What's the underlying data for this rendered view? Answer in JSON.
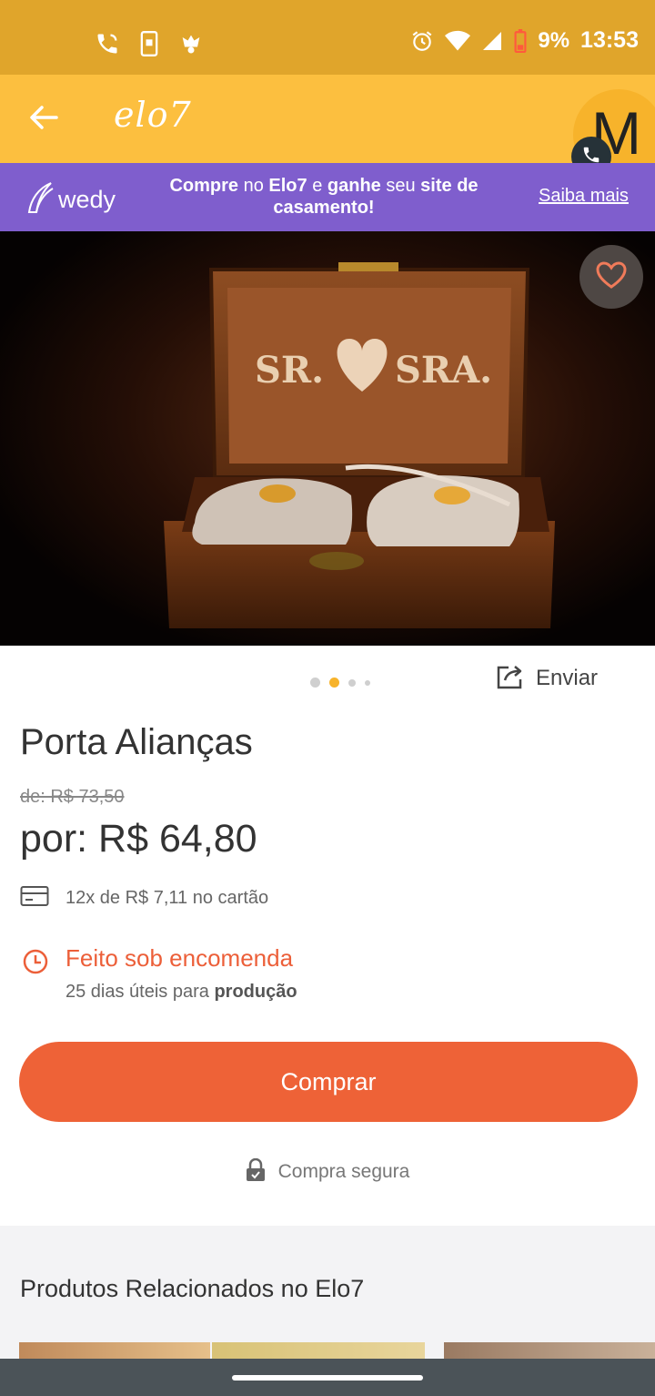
{
  "status_bar": {
    "time": "13:53",
    "battery": "9%",
    "icons_left": [
      "call-icon",
      "phone-screen-icon",
      "app-notification-icon"
    ],
    "icons_right": [
      "alarm-icon",
      "wifi-icon",
      "signal-icon",
      "battery-low-icon"
    ]
  },
  "app_bar": {
    "logo": "elo7",
    "avatar_letter": "M"
  },
  "banner": {
    "brand": "wedy",
    "text_part1": "Compre",
    "text_part2": " no ",
    "text_part3": "Elo7",
    "text_part4": " e ",
    "text_part5": "ganhe",
    "text_part6": " seu ",
    "text_part7": "site de casamento!",
    "link": "Saiba mais",
    "color": "#7f5ecd"
  },
  "hero": {
    "box_text_left": "SR.",
    "box_text_right": "SRA.",
    "carousel_total": 4,
    "carousel_active": 2
  },
  "share": {
    "label": "Enviar"
  },
  "product": {
    "title": "Porta Alianças",
    "old_price": "de: R$ 73,50",
    "price": "por: R$ 64,80",
    "installments": "12x de R$ 7,11 no cartão",
    "made_to_order": "Feito sob encomenda",
    "production_prefix": "25 dias úteis para ",
    "production_bold": "produção"
  },
  "buy_button": {
    "label": "Comprar",
    "color": "#ee6237"
  },
  "secure": {
    "label": "Compra segura"
  },
  "related": {
    "title": "Produtos Relacionados no Elo7"
  },
  "colors": {
    "status_bar": "#e0a52b",
    "app_bar": "#fcbf3f",
    "accent": "#ec5f39"
  }
}
